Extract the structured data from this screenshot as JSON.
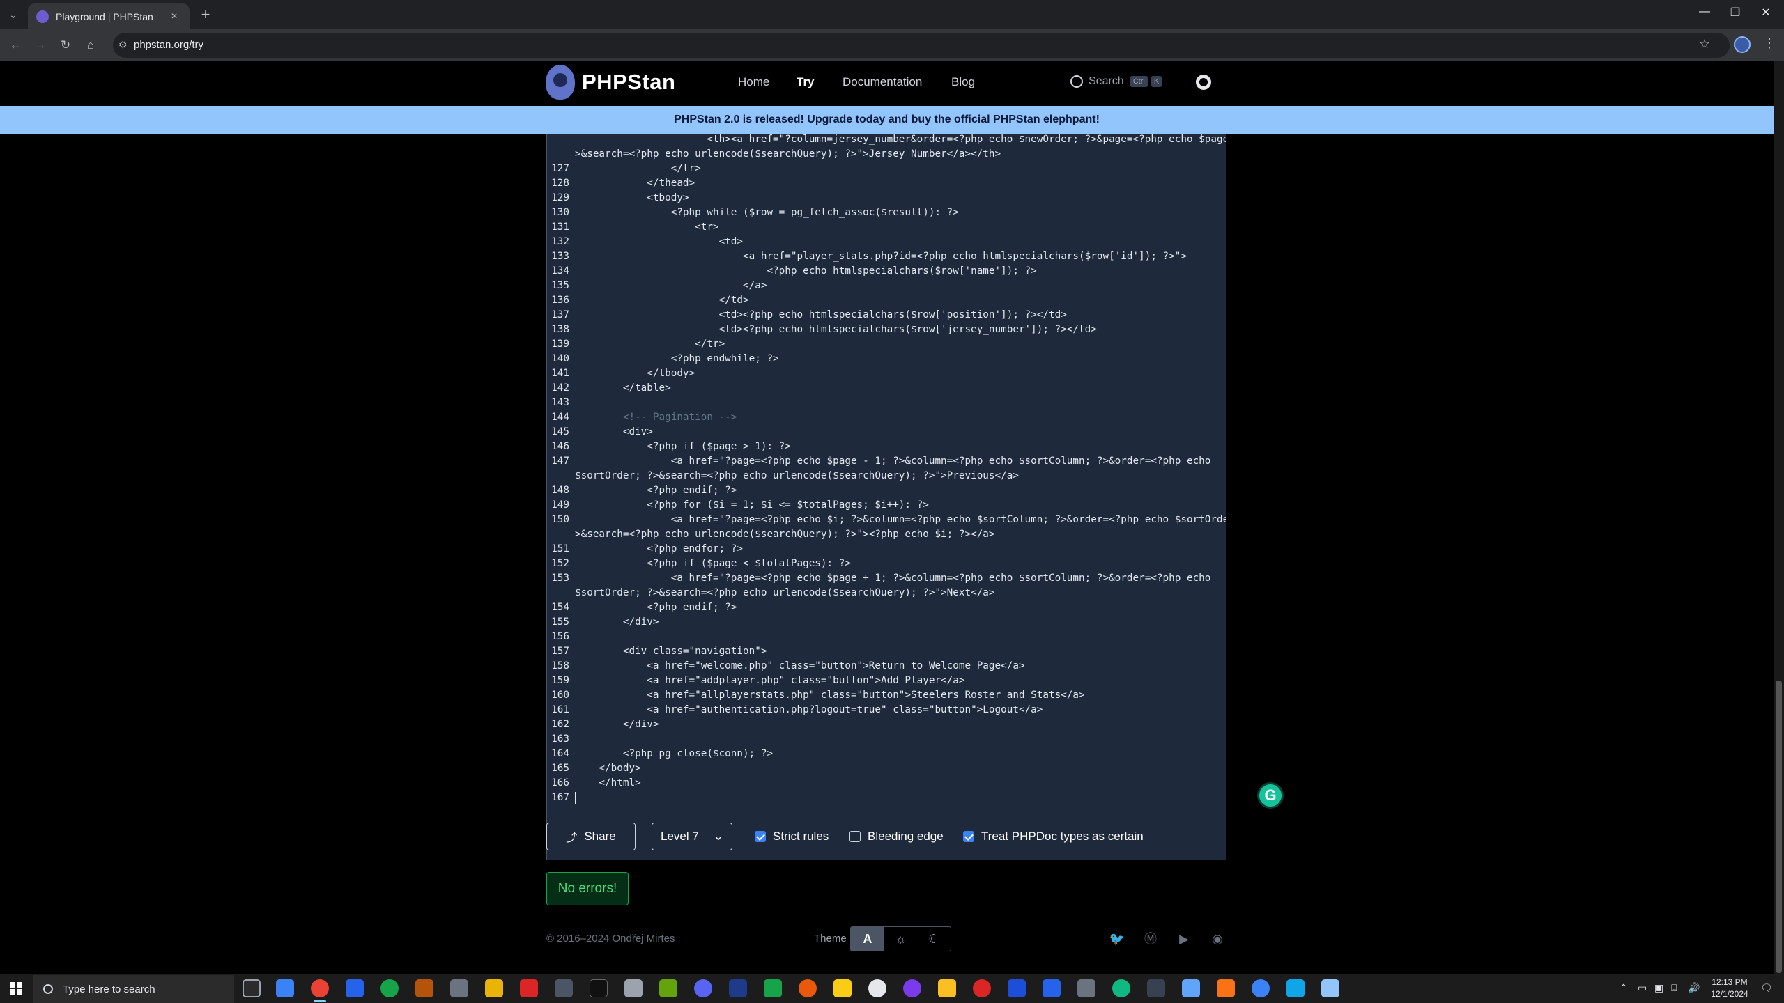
{
  "browser": {
    "tab_title": "Playground | PHPStan",
    "new_tab_label": "+",
    "url": "phpstan.org/try",
    "window_controls": [
      "—",
      "❐",
      "✕"
    ]
  },
  "site": {
    "logo_text": "PHPStan",
    "nav": [
      "Home",
      "Try",
      "Documentation",
      "Blog"
    ],
    "search_label": "Search",
    "search_key_1": "Ctrl",
    "search_key_2": "K",
    "banner": "PHPStan 2.0 is released! Upgrade today and buy the official PHPStan elephpant!"
  },
  "editor": {
    "lines": [
      {
        "n": "",
        "t": "                      <th><a href=\"?column=jersey_number&order=<?php echo $newOrder; ?>&page=<?php echo $page; ?"
      },
      {
        "n": "",
        "t": ">&search=<?php echo urlencode($searchQuery); ?>\">Jersey Number</a></th>"
      },
      {
        "n": "127",
        "t": "                </tr>"
      },
      {
        "n": "128",
        "t": "            </thead>"
      },
      {
        "n": "129",
        "t": "            <tbody>"
      },
      {
        "n": "130",
        "t": "                <?php while ($row = pg_fetch_assoc($result)): ?>"
      },
      {
        "n": "131",
        "t": "                    <tr>"
      },
      {
        "n": "132",
        "t": "                        <td>"
      },
      {
        "n": "133",
        "t": "                            <a href=\"player_stats.php?id=<?php echo htmlspecialchars($row['id']); ?>\">"
      },
      {
        "n": "134",
        "t": "                                <?php echo htmlspecialchars($row['name']); ?>"
      },
      {
        "n": "135",
        "t": "                            </a>"
      },
      {
        "n": "136",
        "t": "                        </td>"
      },
      {
        "n": "137",
        "t": "                        <td><?php echo htmlspecialchars($row['position']); ?></td>"
      },
      {
        "n": "138",
        "t": "                        <td><?php echo htmlspecialchars($row['jersey_number']); ?></td>"
      },
      {
        "n": "139",
        "t": "                    </tr>"
      },
      {
        "n": "140",
        "t": "                <?php endwhile; ?>"
      },
      {
        "n": "141",
        "t": "            </tbody>"
      },
      {
        "n": "142",
        "t": "        </table>"
      },
      {
        "n": "143",
        "t": ""
      },
      {
        "n": "144",
        "t": "        <!-- Pagination -->"
      },
      {
        "n": "145",
        "t": "        <div>"
      },
      {
        "n": "146",
        "t": "            <?php if ($page > 1): ?>"
      },
      {
        "n": "147",
        "t": "                <a href=\"?page=<?php echo $page - 1; ?>&column=<?php echo $sortColumn; ?>&order=<?php echo"
      },
      {
        "n": "",
        "t": "$sortOrder; ?>&search=<?php echo urlencode($searchQuery); ?>\">Previous</a>"
      },
      {
        "n": "148",
        "t": "            <?php endif; ?>"
      },
      {
        "n": "149",
        "t": "            <?php for ($i = 1; $i <= $totalPages; $i++): ?>"
      },
      {
        "n": "150",
        "t": "                <a href=\"?page=<?php echo $i; ?>&column=<?php echo $sortColumn; ?>&order=<?php echo $sortOrder; ?"
      },
      {
        "n": "",
        "t": ">&search=<?php echo urlencode($searchQuery); ?>\"><?php echo $i; ?></a>"
      },
      {
        "n": "151",
        "t": "            <?php endfor; ?>"
      },
      {
        "n": "152",
        "t": "            <?php if ($page < $totalPages): ?>"
      },
      {
        "n": "153",
        "t": "                <a href=\"?page=<?php echo $page + 1; ?>&column=<?php echo $sortColumn; ?>&order=<?php echo"
      },
      {
        "n": "",
        "t": "$sortOrder; ?>&search=<?php echo urlencode($searchQuery); ?>\">Next</a>"
      },
      {
        "n": "154",
        "t": "            <?php endif; ?>"
      },
      {
        "n": "155",
        "t": "        </div>"
      },
      {
        "n": "156",
        "t": ""
      },
      {
        "n": "157",
        "t": "        <div class=\"navigation\">"
      },
      {
        "n": "158",
        "t": "            <a href=\"welcome.php\" class=\"button\">Return to Welcome Page</a>"
      },
      {
        "n": "159",
        "t": "            <a href=\"addplayer.php\" class=\"button\">Add Player</a>"
      },
      {
        "n": "160",
        "t": "            <a href=\"allplayerstats.php\" class=\"button\">Steelers Roster and Stats</a>"
      },
      {
        "n": "161",
        "t": "            <a href=\"authentication.php?logout=true\" class=\"button\">Logout</a>"
      },
      {
        "n": "162",
        "t": "        </div>"
      },
      {
        "n": "163",
        "t": ""
      },
      {
        "n": "164",
        "t": "        <?php pg_close($conn); ?>"
      },
      {
        "n": "165",
        "t": "    </body>"
      },
      {
        "n": "166",
        "t": "    </html>"
      },
      {
        "n": "167",
        "t": ""
      }
    ]
  },
  "controls": {
    "share_label": "Share",
    "level_label": "Level 7",
    "strict_rules": "Strict rules",
    "bleeding_edge": "Bleeding edge",
    "treat_phpdoc": "Treat PHPDoc types as certain",
    "strict_checked": true,
    "bleeding_checked": false,
    "phpdoc_checked": true
  },
  "result": "No errors!",
  "footer": {
    "copyright": "© 2016–2024 Ondřej Mirtes",
    "theme_label": "Theme",
    "theme_options": [
      "A",
      "☼",
      "☾"
    ]
  },
  "taskbar": {
    "search_placeholder": "Type here to search",
    "time": "12:13 PM",
    "date": "12/1/2024"
  },
  "colors": {
    "banner": "#93c5fd",
    "editor_bg": "#1e293b",
    "success": "#4ade80",
    "accent": "#3b82f6"
  }
}
